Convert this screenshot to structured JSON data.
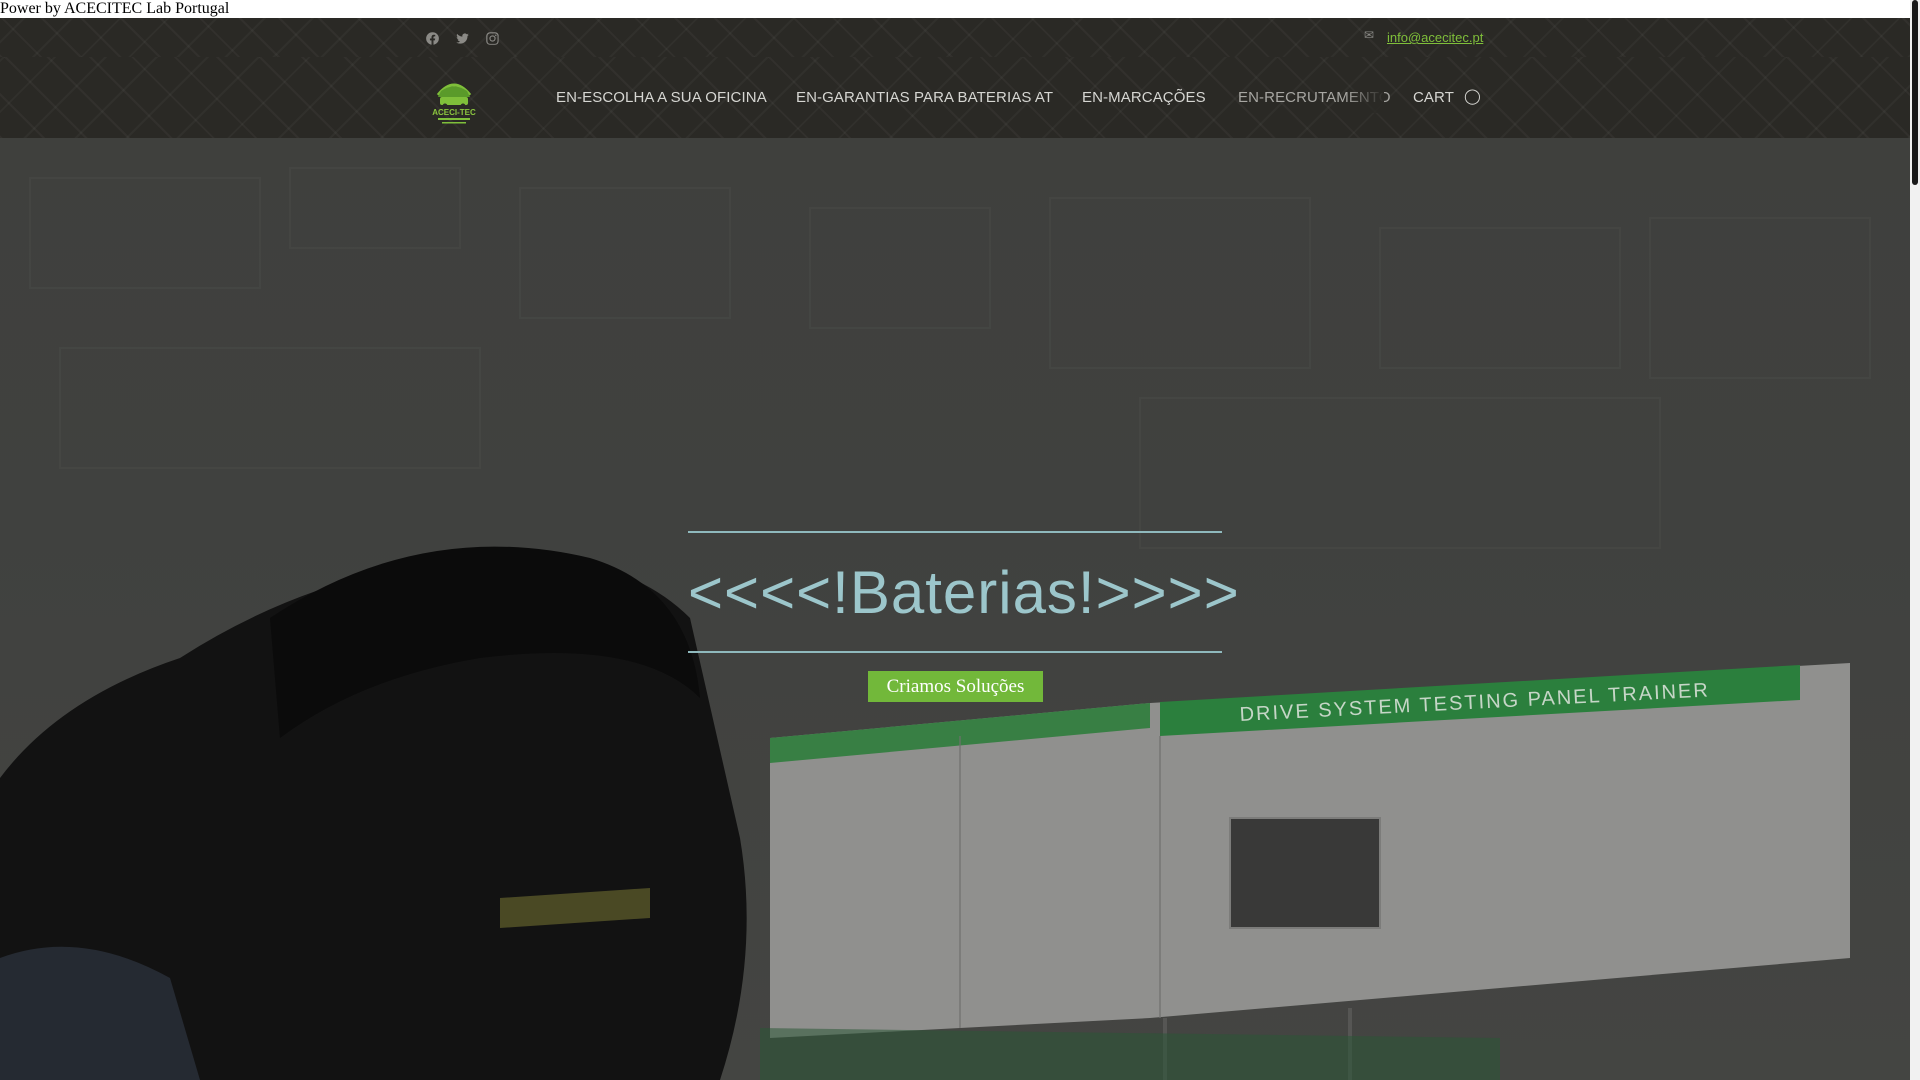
{
  "power_bar": {
    "text": "Power by ACECITEC Lab Portugal"
  },
  "topbar": {
    "social_icons": [
      "facebook-icon",
      "twitter-icon",
      "instagram-icon"
    ],
    "email": "info@acecitec.pt"
  },
  "navbar": {
    "logo_text": "ACECI-TEC",
    "items": [
      {
        "label": "EN-ESCOLHA A SUA OFICINA"
      },
      {
        "label": "EN-GARANTIAS PARA BATERIAS AT"
      },
      {
        "label": "EN-MARCAÇÕES"
      },
      {
        "label": "EN-RECRUTAMENTO"
      },
      {
        "label": "CART"
      }
    ]
  },
  "hero": {
    "title": "<<<<!Baterias!>>>>",
    "cta_label": "Criamos Soluções",
    "panel_sign": "DRIVE SYSTEM TESTING PANEL TRAINER"
  },
  "colors": {
    "accent_green": "#72b83a",
    "link_green": "#7fbf3a",
    "title_teal": "#9cc6cb",
    "header_dark": "#2a2925"
  }
}
